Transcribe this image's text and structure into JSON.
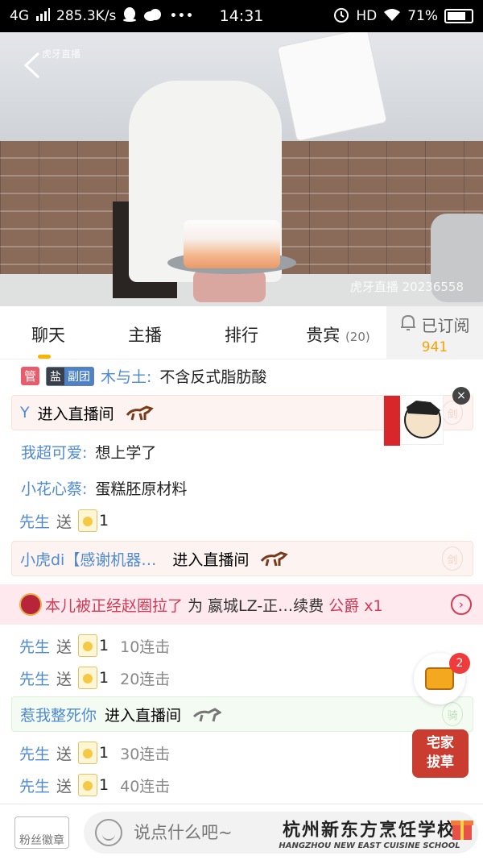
{
  "status_bar": {
    "network": "4G",
    "speed": "285.3K/s",
    "more": "•••",
    "time": "14:31",
    "hd": "HD",
    "battery": "71%"
  },
  "video": {
    "watermark_top": "虎牙直播",
    "watermark_bottom": "虎牙直播 20236558"
  },
  "tabs": [
    {
      "label": "聊天",
      "active": true
    },
    {
      "label": "主播",
      "active": false
    },
    {
      "label": "排行",
      "active": false
    },
    {
      "label": "贵宾",
      "count": "(20)",
      "active": false
    }
  ],
  "subscribe": {
    "label": "已订阅",
    "count": "941"
  },
  "chat": {
    "msg1": {
      "badge_manager": "管",
      "badge_fan_salt": "盐",
      "badge_fan_team": "副团",
      "user": "木与土:",
      "text": "不含反式脂肪酸"
    },
    "enter1": {
      "user": "Y",
      "text": "进入直播间",
      "mark": "剑"
    },
    "msg2": {
      "user": "我超可爱:",
      "text": "想上学了"
    },
    "msg3": {
      "user": "小花心蔡:",
      "text": "蛋糕胚原材料"
    },
    "gift1": {
      "user": "先生",
      "verb": "送",
      "qty": "1"
    },
    "enter2": {
      "user": "小虎di【感谢机器…",
      "text": "进入直播间",
      "mark": "剑"
    },
    "banner": {
      "user": "本儿被正经赵圈拉了",
      "text": "为 嬴城LZ-正…续费",
      "rank": "公爵 x1",
      "arrow": "›"
    },
    "gift2": {
      "user": "先生",
      "verb": "送",
      "qty": "1",
      "combo": "10连击"
    },
    "gift3": {
      "user": "先生",
      "verb": "送",
      "qty": "1",
      "combo": "20连击"
    },
    "enter3": {
      "user": "惹我整死你",
      "text": "进入直播间",
      "mark": "骑"
    },
    "gift4": {
      "user": "先生",
      "verb": "送",
      "qty": "1",
      "combo": "30连击"
    },
    "gift5": {
      "user": "先生",
      "verb": "送",
      "qty": "1",
      "combo": "40连击"
    }
  },
  "promo": {
    "close": "×",
    "treasure_count": "2",
    "promo2_line1": "宅家",
    "promo2_line2": "拔草"
  },
  "bottom": {
    "fan_badge": "粉丝徽章",
    "input_placeholder": "说点什么吧~",
    "school_cn": "杭州新东方烹饪学校",
    "school_en": "HANGZHOU NEW EAST CUISINE SCHOOL"
  },
  "colors": {
    "accent": "#f7b500",
    "username": "#4f8ad4",
    "banner": "#d23a55"
  }
}
